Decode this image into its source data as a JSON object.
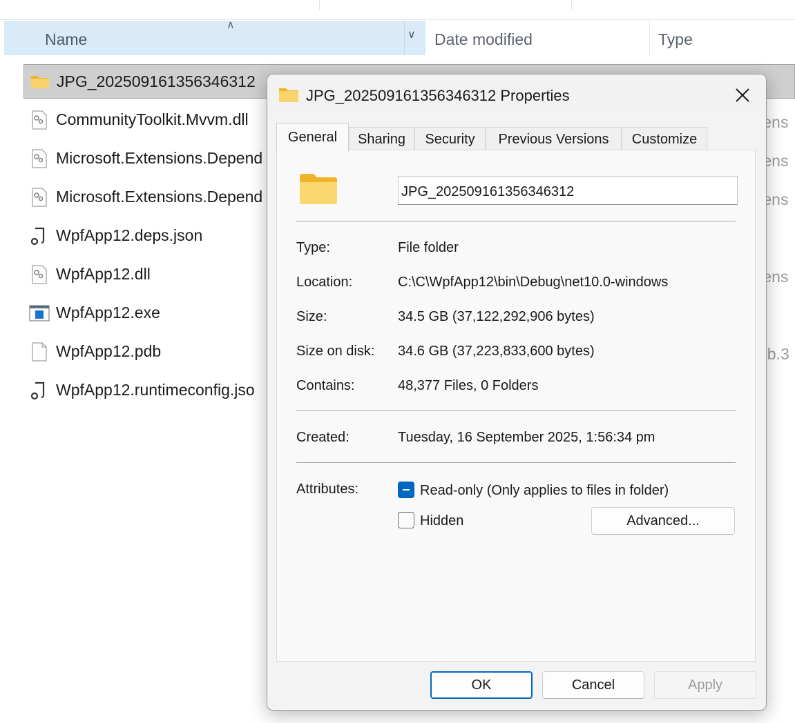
{
  "explorer": {
    "columns": {
      "name": "Name",
      "date_modified": "Date modified",
      "type": "Type"
    },
    "files": [
      {
        "name": "JPG_20250916135634631​2",
        "icon": "folder-icon",
        "selected": true
      },
      {
        "name": "CommunityToolkit.Mvvm.dll",
        "icon": "dll-icon"
      },
      {
        "name": "Microsoft.Extensions.Depend",
        "icon": "dll-icon"
      },
      {
        "name": "Microsoft.Extensions.Depend",
        "icon": "dll-icon"
      },
      {
        "name": "WpfApp12.deps.json",
        "icon": "json-icon"
      },
      {
        "name": "WpfApp12.dll",
        "icon": "dll-icon"
      },
      {
        "name": "WpfApp12.exe",
        "icon": "exe-icon"
      },
      {
        "name": "WpfApp12.pdb",
        "icon": "file-icon"
      },
      {
        "name": "WpfApp12.runtimeconfig.jso",
        "icon": "json-icon"
      }
    ],
    "type_fragments": [
      "tens",
      "tens",
      "tens",
      "tens",
      "db.3"
    ]
  },
  "dialog": {
    "title": "JPG_20250916135634631​2 Properties",
    "tabs": [
      "General",
      "Sharing",
      "Security",
      "Previous Versions",
      "Customize"
    ],
    "active_tab": "General",
    "folder_name": "JPG_20250916135634631​2",
    "labels": {
      "type": "Type:",
      "location": "Location:",
      "size": "Size:",
      "size_on_disk": "Size on disk:",
      "contains": "Contains:",
      "created": "Created:",
      "attributes": "Attributes:"
    },
    "values": {
      "type": "File folder",
      "location": "C:\\C\\WpfApp12\\bin\\Debug\\net10.0-windows",
      "size": "34.5 GB (37,122,292,906 bytes)",
      "size_on_disk": "34.6 GB (37,223,833,600 bytes)",
      "contains": "48,377 Files, 0 Folders",
      "created": "Tuesday, 16 September 2025, 1:56:34 pm"
    },
    "attributes": {
      "readonly_label": "Read-only (Only applies to files in folder)",
      "readonly_state": "indeterminate",
      "hidden_label": "Hidden",
      "hidden_state": "unchecked",
      "advanced_button": "Advanced..."
    },
    "buttons": {
      "ok": "OK",
      "cancel": "Cancel",
      "apply": "Apply"
    },
    "colors": {
      "accent": "#0067c0",
      "folder": "#f8c842"
    }
  }
}
